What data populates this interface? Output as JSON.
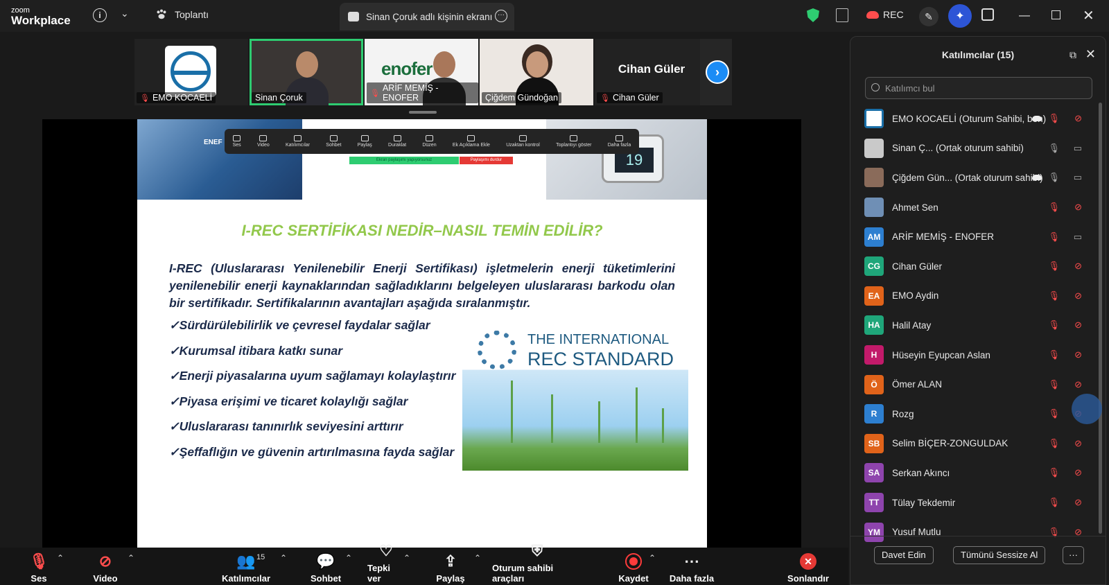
{
  "app": {
    "logo_top": "zoom",
    "logo_bottom": "Workplace",
    "meeting_tab": "Toplantı",
    "share_tab": "Sinan Çoruk adlı kişinin ekranı",
    "rec_label": "REC"
  },
  "thumbnails": [
    {
      "name": "EMO KOCAELİ"
    },
    {
      "name": "Sinan Çoruk"
    },
    {
      "name": "ARİF MEMİŞ - ENOFER"
    },
    {
      "name": "Çiğdem Gündoğan"
    },
    {
      "name": "Cihan Güler",
      "big_name": "Cihan Güler"
    }
  ],
  "enofer_logo": "enofer",
  "slide": {
    "title": "I-REC SERTİFİKASI NEDİR–NASIL TEMİN EDİLİR?",
    "paragraph": "I-REC (Uluslararası Yenilenebilir Enerji Sertifikası) işletmelerin enerji tüketimlerini yenilenebilir enerji kaynaklarından sağladıklarını belgeleyen uluslararası barkodu olan bir sertifikadır. Sertifikalarının avantajları aşağıda sıralanmıştır.",
    "bullets": [
      "✓Sürdürülebilirlik ve çevresel faydalar sağlar",
      "✓Kurumsal itibara katkı sunar",
      "✓Enerji piyasalarına uyum sağlamayı kolaylaştırır",
      "✓Piyasa erişimi ve ticaret kolaylığı sağlar",
      "✓Uluslararası tanınırlık seviyesini arttırır",
      "✓Şeffaflığın ve güvenin artırılmasına fayda sağlar"
    ],
    "image_line1": "THE INTERNATIONAL",
    "image_line2": "REC STANDARD",
    "header_left_text": "ENEF EFFICI",
    "thermo_value": "19"
  },
  "mini_toolbar": {
    "items": [
      "Ses",
      "Video",
      "Katılımcılar",
      "Sohbet",
      "Paylaş",
      "Duraklat",
      "Düzen",
      "Ek Açıklama Ekle",
      "Uzaktan kontrol",
      "Toplantıyı göster",
      "Daha fazla"
    ],
    "green_bar": "Ekran paylaşımı yapıyorsunuz",
    "red_bar": "Paylaşımı durdur"
  },
  "controls": {
    "audio": "Ses",
    "video": "Video",
    "participants": "Katılımcılar",
    "participants_count": "15",
    "chat": "Sohbet",
    "react": "Tepki ver",
    "share": "Paylaş",
    "host_tools": "Oturum sahibi araçları",
    "record": "Kaydet",
    "more": "Daha fazla",
    "end": "Sonlandır"
  },
  "panel": {
    "title": "Katılımcılar (15)",
    "search_placeholder": "Katılımcı bul",
    "invite": "Davet Edin",
    "mute_all": "Tümünü Sessize Al",
    "more": "···",
    "participants": [
      {
        "initials": "",
        "name": "EMO KOCAELİ (Oturum Sahibi, ben)",
        "color": "#ffffff",
        "mic": "off",
        "cam": "off",
        "cloud": true
      },
      {
        "initials": "",
        "name": "Sinan Ç...  (Ortak oturum sahibi)",
        "color": "#c9c9c9",
        "mic": "on",
        "cam": "on",
        "cloud": false
      },
      {
        "initials": "",
        "name": "Çiğdem Gün... (Ortak oturum sahibi)",
        "color": "#8a6b5a",
        "mic": "on",
        "cam": "on",
        "cloud": true
      },
      {
        "initials": "",
        "name": "Ahmet Sen",
        "color": "#6f8fb5",
        "mic": "off",
        "cam": "off",
        "cloud": false
      },
      {
        "initials": "AM",
        "name": "ARİF MEMİŞ - ENOFER",
        "color": "#2d7fd0",
        "mic": "off",
        "cam": "on",
        "cloud": false
      },
      {
        "initials": "CG",
        "name": "Cihan Güler",
        "color": "#1fa67a",
        "mic": "off",
        "cam": "off",
        "cloud": false
      },
      {
        "initials": "EA",
        "name": "EMO Aydin",
        "color": "#e0631a",
        "mic": "off",
        "cam": "off",
        "cloud": false
      },
      {
        "initials": "HA",
        "name": "Halil Atay",
        "color": "#1fa67a",
        "mic": "off",
        "cam": "off",
        "cloud": false
      },
      {
        "initials": "H",
        "name": "Hüseyin Eyupcan Aslan",
        "color": "#c21a6a",
        "mic": "off",
        "cam": "off",
        "cloud": false
      },
      {
        "initials": "Ö",
        "name": "Ömer ALAN",
        "color": "#e0631a",
        "mic": "off",
        "cam": "off",
        "cloud": false
      },
      {
        "initials": "R",
        "name": "Rozg",
        "color": "#2d7fd0",
        "mic": "off",
        "cam": "off",
        "cloud": false
      },
      {
        "initials": "SB",
        "name": "Selim BİÇER-ZONGULDAK",
        "color": "#e0631a",
        "mic": "off",
        "cam": "off",
        "cloud": false
      },
      {
        "initials": "SA",
        "name": "Serkan Akıncı",
        "color": "#8e44ad",
        "mic": "off",
        "cam": "off",
        "cloud": false
      },
      {
        "initials": "TT",
        "name": "Tülay Tekdemir",
        "color": "#8e44ad",
        "mic": "off",
        "cam": "off",
        "cloud": false
      },
      {
        "initials": "YM",
        "name": "Yusuf Mutlu",
        "color": "#8e44ad",
        "mic": "off",
        "cam": "off",
        "cloud": false
      }
    ]
  }
}
